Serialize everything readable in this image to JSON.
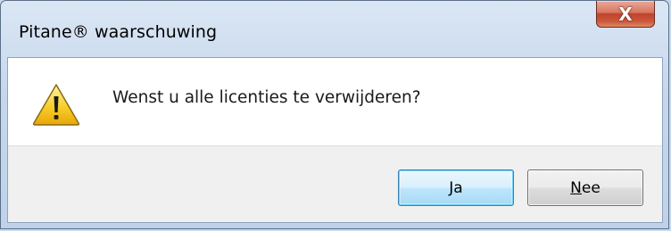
{
  "window": {
    "title": "Pitane® waarschuwing",
    "close_glyph": "X"
  },
  "dialog": {
    "icon": "warning-icon",
    "message": "Wenst u alle licenties te verwijderen?"
  },
  "buttons": {
    "yes_label": "Ja",
    "no_label": "Nee",
    "default": "yes"
  },
  "colors": {
    "warning_yellow": "#f4c20d",
    "close_red": "#c0422b",
    "default_button_border": "#3c7fb1"
  }
}
